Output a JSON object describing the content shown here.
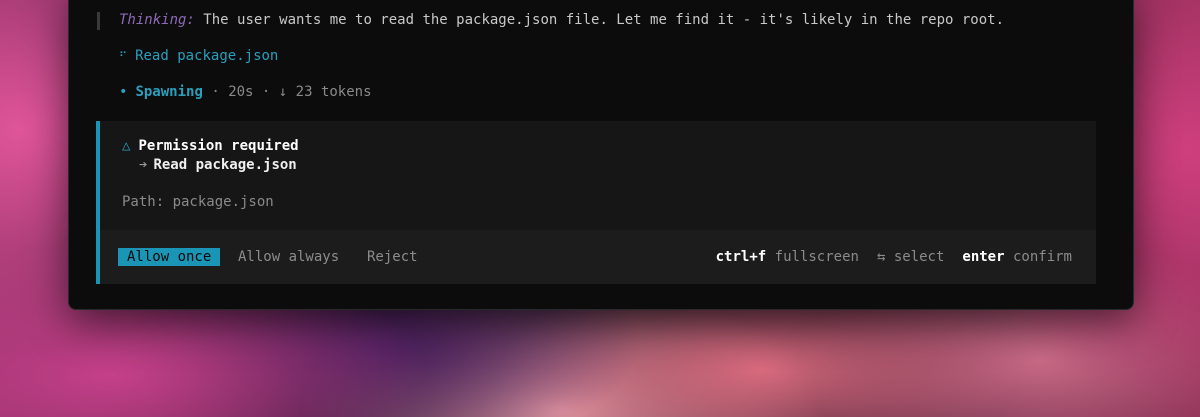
{
  "thinking": {
    "label": "Thinking:",
    "text": "The user wants me to read the package.json file. Let me find it - it's likely in the repo root."
  },
  "tool_call": {
    "icon": "braille-dots-icon",
    "icon_glyph": "⠋",
    "label": "Read package.json"
  },
  "status": {
    "icon_glyph": "•",
    "label": "Spawning",
    "sep1": "·",
    "elapsed": "20s",
    "sep2": "·",
    "tokens": "↓ 23 tokens"
  },
  "permission": {
    "warn_glyph": "△",
    "title": "Permission required",
    "arrow_glyph": "➔",
    "action": "Read package.json",
    "path": "Path: package.json",
    "accent_color": "#1a95b5"
  },
  "actions": {
    "allow_once": "Allow once",
    "allow_always": "Allow always",
    "reject": "Reject"
  },
  "hints": {
    "fullscreen_key": "ctrl+f",
    "fullscreen_label": "fullscreen",
    "select_glyph": "⇆",
    "select_label": "select",
    "confirm_key": "enter",
    "confirm_label": "confirm"
  }
}
